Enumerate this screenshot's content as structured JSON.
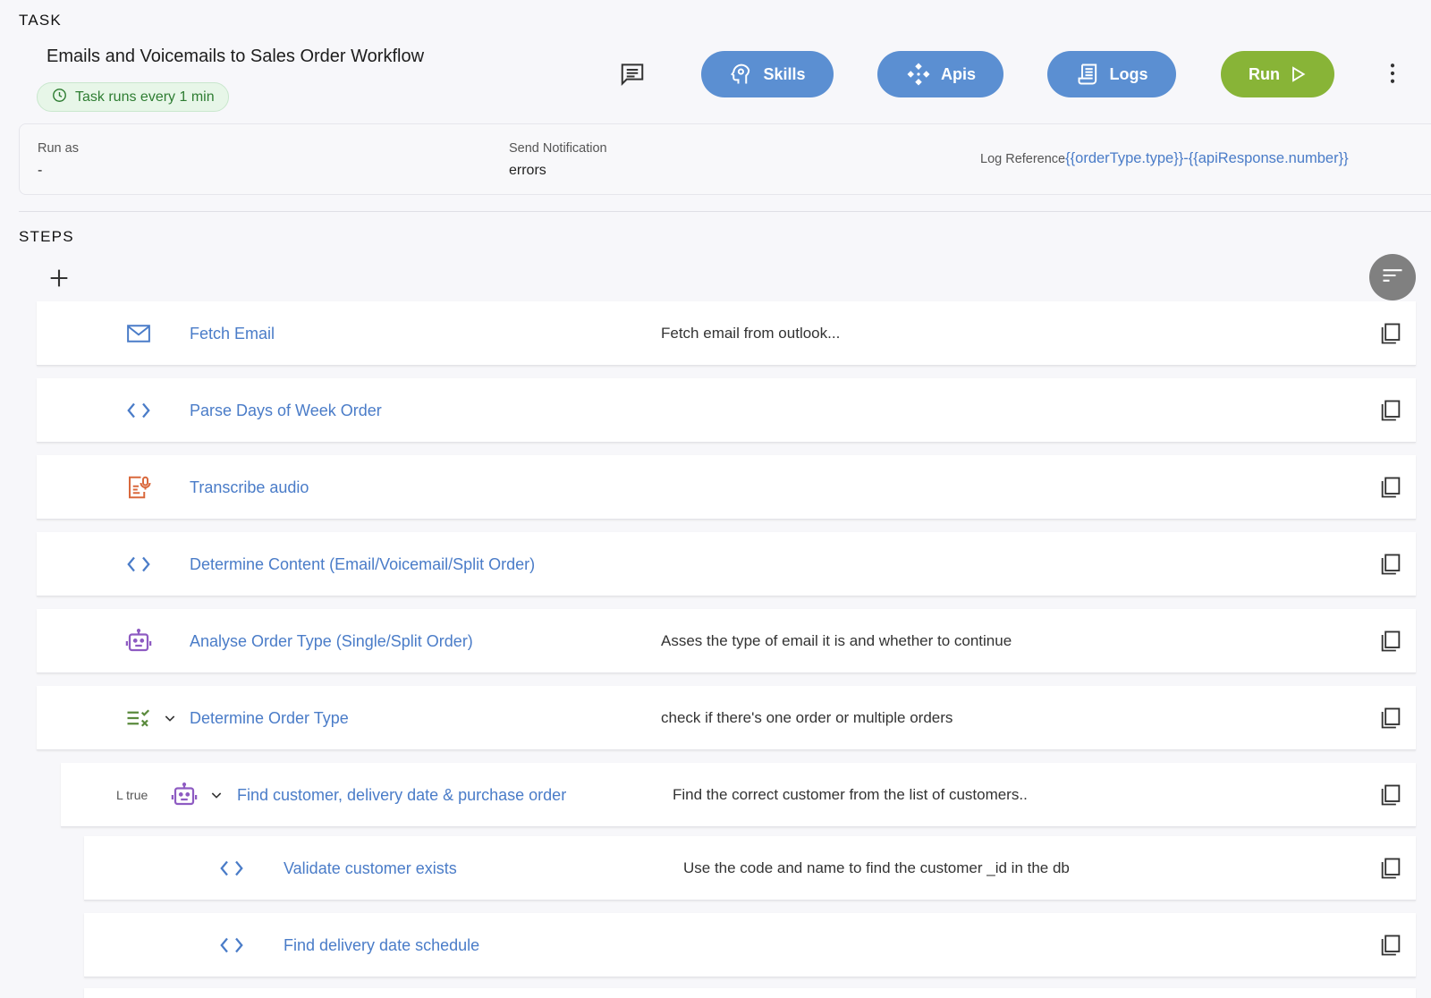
{
  "task": {
    "section_label": "TASK",
    "title": "Emails and Voicemails to Sales Order Workflow",
    "schedule": "Task runs every 1 min",
    "buttons": {
      "skills": "Skills",
      "apis": "Apis",
      "logs": "Logs",
      "run": "Run"
    },
    "info": {
      "run_as_label": "Run as",
      "run_as_value": "-",
      "notification_label": "Send Notification",
      "notification_value": "errors",
      "log_reference_label": "Log Reference",
      "log_reference_value": "{{orderType.type}}-{{apiResponse.number}}"
    }
  },
  "steps": {
    "section_label": "STEPS",
    "items": [
      {
        "name": "Fetch Email",
        "description": "Fetch email from outlook...",
        "icon": "mail-icon"
      },
      {
        "name": "Parse Days of Week Order",
        "description": "",
        "icon": "code-icon"
      },
      {
        "name": "Transcribe audio",
        "description": "",
        "icon": "transcribe-icon"
      },
      {
        "name": "Determine Content (Email/Voicemail/Split Order)",
        "description": "",
        "icon": "code-icon"
      },
      {
        "name": "Analyse Order Type (Single/Split Order)",
        "description": "Asses the type of email it is and whether to continue",
        "icon": "robot-icon"
      },
      {
        "name": "Determine Order Type",
        "description": "check if there's one order or multiple orders",
        "icon": "condition-icon"
      },
      {
        "name": "Find customer, delivery date & purchase order",
        "description": "Find the correct customer from the list of customers..",
        "icon": "robot-icon",
        "branch": "L true"
      },
      {
        "name": "Validate customer exists",
        "description": "Use the code and name to find the customer _id in the db",
        "icon": "code-icon"
      },
      {
        "name": "Find delivery date schedule",
        "description": "",
        "icon": "code-icon"
      }
    ]
  },
  "colors": {
    "link": "#4a7cc8",
    "pill": "#5b8fd2",
    "run": "#88b437",
    "chip_text": "#2e7d32",
    "robot": "#8e5bc2",
    "transcribe": "#d9683c",
    "condition": "#5a8a3c"
  }
}
